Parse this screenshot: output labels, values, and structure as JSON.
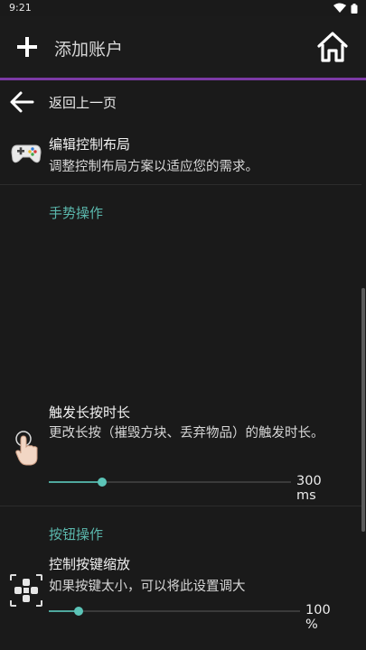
{
  "status_bar": {
    "time": "9:21",
    "wifi_icon": "wifi-icon",
    "battery_icon": "battery-icon"
  },
  "app_bar": {
    "title": "添加账户",
    "add_icon": "plus-icon",
    "home_icon": "home-icon",
    "accent_color": "#7c3aa6"
  },
  "back": {
    "label": "返回上一页",
    "icon": "arrow-left-icon"
  },
  "edit_layout": {
    "title": "编辑控制布局",
    "description": "调整控制布局方案以适应您的需求。",
    "icon": "gamepad-icon"
  },
  "gesture_section": {
    "header": "手势操作",
    "long_press": {
      "title": "触发长按时长",
      "description": "更改长按（摧毁方块、丢弃物品）的触发时长。",
      "value_text": "300 ms",
      "slider_fraction": 0.22,
      "icon": "touch-hand-icon"
    }
  },
  "button_section": {
    "header": "按钮操作",
    "scale": {
      "title": "控制按键缩放",
      "description": "如果按键太小，可以将此设置调大",
      "value_text": "100 %",
      "slider_fraction": 0.12,
      "icon": "dpad-icon"
    }
  },
  "colors": {
    "section_header": "#5bb8ad",
    "slider_active": "#4fa89e",
    "background": "#1a1a1a"
  }
}
